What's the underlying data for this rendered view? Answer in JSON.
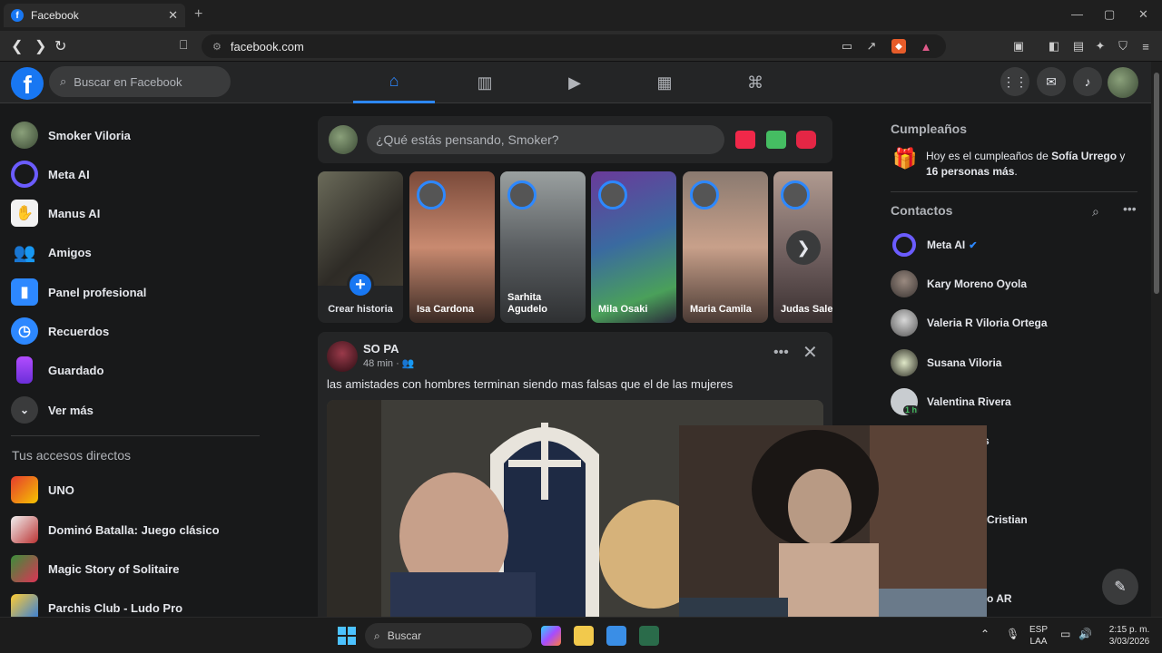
{
  "browser": {
    "tab_title": "Facebook",
    "tab_favicon": "f",
    "tab_close": "✕",
    "new_tab": "+",
    "url": "facebook.com"
  },
  "header": {
    "search_placeholder": "Buscar en Facebook",
    "nav_tabs": [
      "home-icon",
      "dashboard-icon",
      "video-icon",
      "marketplace-icon",
      "gaming-icon"
    ],
    "active_tab": "home-icon",
    "accent": "#2d88ff"
  },
  "sidebar": {
    "items": [
      {
        "label": "Smoker Viloria",
        "icon": "avatar"
      },
      {
        "label": "Meta AI",
        "icon": "meta-ai-icon"
      },
      {
        "label": "Manus AI",
        "icon": "manus-icon"
      },
      {
        "label": "Amigos",
        "icon": "friends-icon"
      },
      {
        "label": "Panel profesional",
        "icon": "dashboard-icon"
      },
      {
        "label": "Recuerdos",
        "icon": "memories-icon"
      },
      {
        "label": "Guardado",
        "icon": "saved-icon"
      },
      {
        "label": "Ver más",
        "icon": "chevron-down-icon"
      }
    ],
    "shortcuts_title": "Tus accesos directos",
    "shortcuts": [
      {
        "label": "UNO"
      },
      {
        "label": "Dominó Batalla: Juego clásico"
      },
      {
        "label": "Magic Story of Solitaire"
      },
      {
        "label": "Parchis Club - Ludo Pro"
      }
    ]
  },
  "composer": {
    "placeholder": "¿Qué estás pensando, Smoker?"
  },
  "stories": {
    "create_label": "Crear historia",
    "items": [
      {
        "name": "Isa Cardona"
      },
      {
        "name": "Sarhita Agudelo"
      },
      {
        "name": "Mila Osaki"
      },
      {
        "name": "Maria Camila"
      },
      {
        "name": "Judas Salem"
      }
    ]
  },
  "post": {
    "author": "SO PA",
    "time": "48 min · ",
    "text": "las amistades con hombres terminan siendo mas falsas que el de las mujeres",
    "more": "•••",
    "close": "✕"
  },
  "right": {
    "birthdays_title": "Cumpleaños",
    "birthday_prefix": "Hoy es el cumpleaños de ",
    "birthday_name": "Sofía Urrego",
    "birthday_mid": " y ",
    "birthday_others": "16 personas más",
    "birthday_suffix": ".",
    "contacts_title": "Contactos",
    "contacts": [
      {
        "name": "Meta AI"
      },
      {
        "name": "Kary Moreno Oyola"
      },
      {
        "name": "Valeria R Viloria Ortega"
      },
      {
        "name": "Susana Viloria"
      },
      {
        "name": "Valentina Rivera",
        "status": "1 h"
      }
    ],
    "partial_contacts": [
      "s",
      "Cristian",
      "o AR"
    ]
  },
  "taskbar": {
    "search_placeholder": "Buscar",
    "lang_top": "ESP",
    "lang_bottom": "LAA",
    "time": "2:15 p. m.",
    "date": "3/03/2026"
  }
}
